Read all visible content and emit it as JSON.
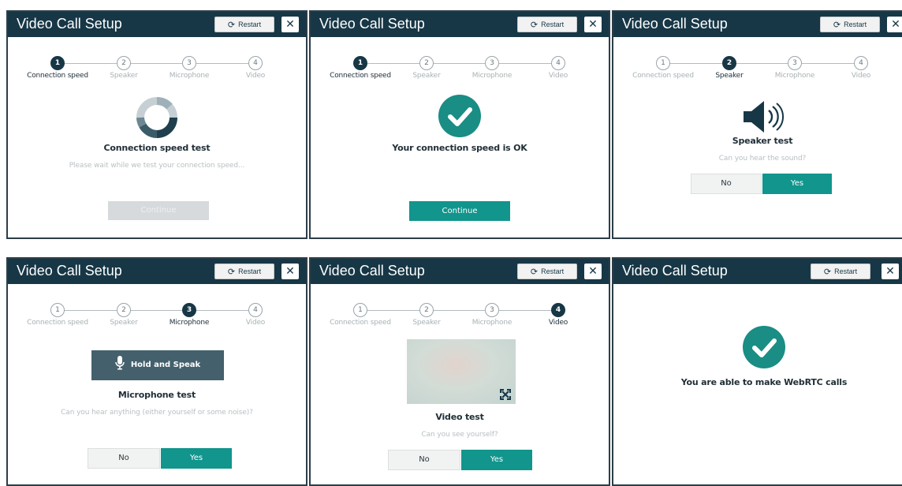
{
  "app": {
    "title": "Video Call Setup",
    "restart_label": "Restart",
    "close_label": "✕"
  },
  "steps": [
    {
      "num": "1",
      "label": "Connection speed"
    },
    {
      "num": "2",
      "label": "Speaker"
    },
    {
      "num": "3",
      "label": "Microphone"
    },
    {
      "num": "4",
      "label": "Video"
    }
  ],
  "panels": {
    "p1": {
      "heading": "Connection speed test",
      "subtext": "Please wait while we test your connection speed...",
      "continue_label": "Continue"
    },
    "p2": {
      "heading": "Your connection speed is OK",
      "continue_label": "Continue"
    },
    "p3": {
      "heading": "Speaker test",
      "subtext": "Can you hear the sound?",
      "no_label": "No",
      "yes_label": "Yes"
    },
    "p4": {
      "hold_label": "Hold and Speak",
      "heading": "Microphone test",
      "subtext": "Can you hear anything (either yourself or some noise)?",
      "no_label": "No",
      "yes_label": "Yes"
    },
    "p5": {
      "heading": "Video test",
      "subtext": "Can you see yourself?",
      "no_label": "No",
      "yes_label": "Yes"
    },
    "p6": {
      "heading": "You are able to make WebRTC calls"
    }
  },
  "colors": {
    "header": "#173746",
    "primary": "#11958c",
    "check": "#1a8d84",
    "active_step": "#173746"
  },
  "icons": [
    "restart-icon",
    "close-icon",
    "spinner-icon",
    "checkmark-icon",
    "speaker-icon",
    "microphone-icon",
    "fullscreen-icon"
  ]
}
